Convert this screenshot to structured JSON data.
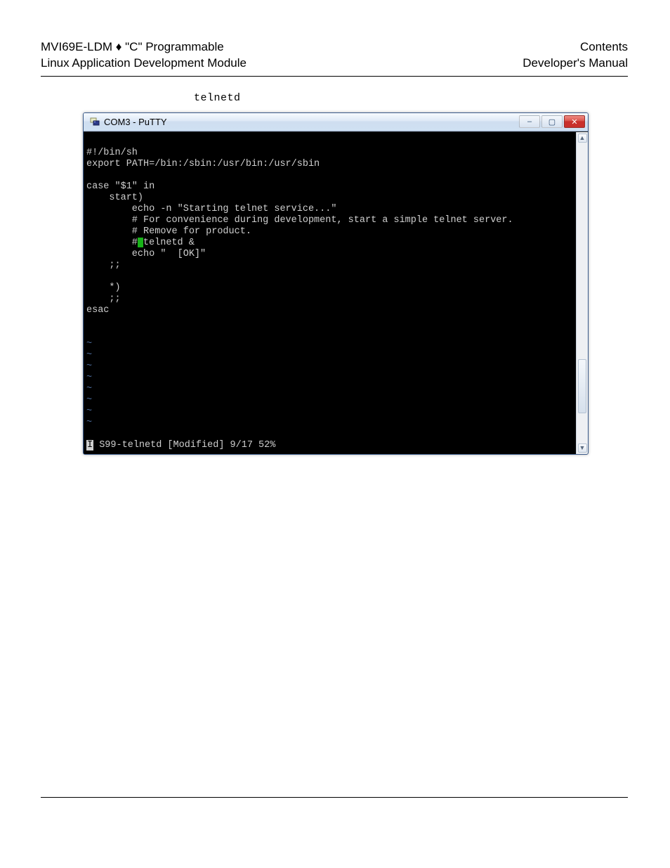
{
  "header": {
    "left_line1": "MVI69E-LDM ♦ \"C\" Programmable",
    "left_line2": "Linux Application Development Module",
    "right_line1": "Contents",
    "right_line2": "Developer's Manual"
  },
  "code_label": "telnetd",
  "putty": {
    "title": "COM3 - PuTTY",
    "controls": {
      "min": "–",
      "max": "▢",
      "close": "✕"
    },
    "scroll": {
      "up": "▲",
      "down": "▼"
    },
    "lines": {
      "l1": "#!/bin/sh",
      "l2": "export PATH=/bin:/sbin:/usr/bin:/usr/sbin",
      "l3": "",
      "l4": "case \"$1\" in",
      "l5": "    start)",
      "l6": "        echo -n \"Starting telnet service...\"",
      "l7": "        # For convenience during development, start a simple telnet server.",
      "l8": "        # Remove for product.",
      "l9a": "        #",
      "l9b": "telnetd &",
      "l10": "        echo \"  [OK]\"",
      "l11": "    ;;",
      "l12": "",
      "l13": "    *)",
      "l14": "    ;;",
      "l15": "esac",
      "l16": "",
      "l17": "",
      "tilde": "~",
      "status_prefix": "I",
      "status_rest": " S99-telnetd [Modified] 9/17 52%"
    }
  }
}
